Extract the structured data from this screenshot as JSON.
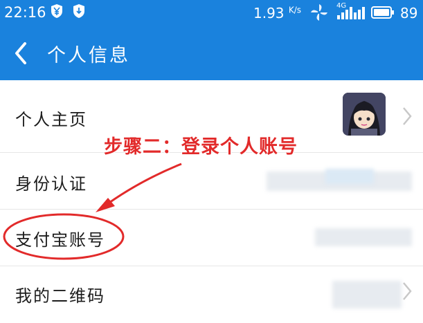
{
  "status_bar": {
    "time": "22:16",
    "net_speed_value": "1.93",
    "net_speed_unit": "K/s",
    "signal_label": "4G",
    "battery_level": "89",
    "left_icons": [
      "yuan-shield-icon",
      "download-shield-icon"
    ],
    "right_icons": [
      "pinwheel-icon",
      "signal-icon",
      "battery-icon"
    ]
  },
  "header": {
    "title": "个人信息",
    "back_icon": "chevron-left-icon"
  },
  "rows": [
    {
      "label": "个人主页"
    },
    {
      "label": "身份认证"
    },
    {
      "label": "支付宝账号"
    },
    {
      "label": "我的二维码"
    }
  ],
  "annotation": {
    "text": "步骤二：登录个人账号"
  },
  "colors": {
    "header_blue": "#1a82dd",
    "annotation_red": "#e22a2a"
  }
}
